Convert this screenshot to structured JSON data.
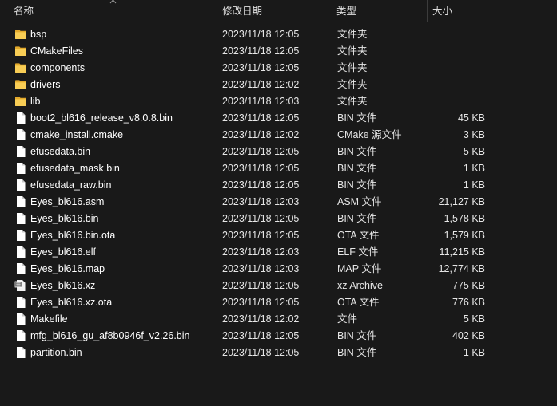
{
  "header": {
    "name": "名称",
    "date": "修改日期",
    "type": "类型",
    "size": "大小"
  },
  "files": [
    {
      "icon": "folder-icon",
      "name": "bsp",
      "date": "2023/11/18 12:05",
      "type": "文件夹",
      "size": ""
    },
    {
      "icon": "folder-icon",
      "name": "CMakeFiles",
      "date": "2023/11/18 12:05",
      "type": "文件夹",
      "size": ""
    },
    {
      "icon": "folder-icon",
      "name": "components",
      "date": "2023/11/18 12:05",
      "type": "文件夹",
      "size": ""
    },
    {
      "icon": "folder-icon",
      "name": "drivers",
      "date": "2023/11/18 12:02",
      "type": "文件夹",
      "size": ""
    },
    {
      "icon": "folder-icon",
      "name": "lib",
      "date": "2023/11/18 12:03",
      "type": "文件夹",
      "size": ""
    },
    {
      "icon": "file-icon",
      "name": "boot2_bl616_release_v8.0.8.bin",
      "date": "2023/11/18 12:05",
      "type": "BIN 文件",
      "size": "45 KB"
    },
    {
      "icon": "file-icon",
      "name": "cmake_install.cmake",
      "date": "2023/11/18 12:02",
      "type": "CMake 源文件",
      "size": "3 KB"
    },
    {
      "icon": "file-icon",
      "name": "efusedata.bin",
      "date": "2023/11/18 12:05",
      "type": "BIN 文件",
      "size": "5 KB"
    },
    {
      "icon": "file-icon",
      "name": "efusedata_mask.bin",
      "date": "2023/11/18 12:05",
      "type": "BIN 文件",
      "size": "1 KB"
    },
    {
      "icon": "file-icon",
      "name": "efusedata_raw.bin",
      "date": "2023/11/18 12:05",
      "type": "BIN 文件",
      "size": "1 KB"
    },
    {
      "icon": "file-icon",
      "name": "Eyes_bl616.asm",
      "date": "2023/11/18 12:03",
      "type": "ASM 文件",
      "size": "21,127 KB"
    },
    {
      "icon": "file-icon",
      "name": "Eyes_bl616.bin",
      "date": "2023/11/18 12:05",
      "type": "BIN 文件",
      "size": "1,578 KB"
    },
    {
      "icon": "file-icon",
      "name": "Eyes_bl616.bin.ota",
      "date": "2023/11/18 12:05",
      "type": "OTA 文件",
      "size": "1,579 KB"
    },
    {
      "icon": "file-icon",
      "name": "Eyes_bl616.elf",
      "date": "2023/11/18 12:03",
      "type": "ELF 文件",
      "size": "11,215 KB"
    },
    {
      "icon": "file-icon",
      "name": "Eyes_bl616.map",
      "date": "2023/11/18 12:03",
      "type": "MAP 文件",
      "size": "12,774 KB"
    },
    {
      "icon": "archive-icon",
      "name": "Eyes_bl616.xz",
      "date": "2023/11/18 12:05",
      "type": "xz Archive",
      "size": "775 KB"
    },
    {
      "icon": "file-icon",
      "name": "Eyes_bl616.xz.ota",
      "date": "2023/11/18 12:05",
      "type": "OTA 文件",
      "size": "776 KB"
    },
    {
      "icon": "file-icon",
      "name": "Makefile",
      "date": "2023/11/18 12:02",
      "type": "文件",
      "size": "5 KB"
    },
    {
      "icon": "file-icon",
      "name": "mfg_bl616_gu_af8b0946f_v2.26.bin",
      "date": "2023/11/18 12:05",
      "type": "BIN 文件",
      "size": "402 KB"
    },
    {
      "icon": "file-icon",
      "name": "partition.bin",
      "date": "2023/11/18 12:05",
      "type": "BIN 文件",
      "size": "1 KB"
    }
  ]
}
